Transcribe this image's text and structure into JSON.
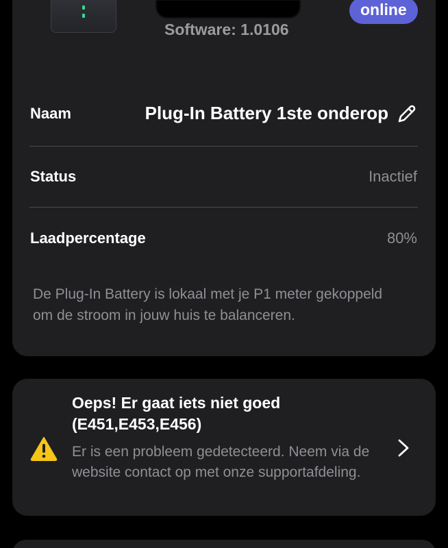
{
  "device": {
    "status_badge": "online",
    "software_version": "Software: 1.0106",
    "name_label": "Naam",
    "name_value": "Plug-In Battery 1ste onderop",
    "status_label": "Status",
    "status_value": "Inactief",
    "charge_label": "Laadpercentage",
    "charge_value": "80%",
    "description": "De Plug-In Battery is lokaal met je P1 meter gekoppeld om de stroom in jouw huis te balanceren."
  },
  "error": {
    "title": "Oeps! Er gaat iets niet goed (E451,E453,E456)",
    "message": "Er is een probleem gedetecteerd. Neem via de website contact op met onze supportafdeling."
  },
  "icons": {
    "edit": "pencil-icon",
    "warning": "warning-triangle-icon",
    "chevron": "chevron-right-icon"
  },
  "colors": {
    "background": "#000000",
    "card": "#1f1f21",
    "accent_badge": "#5d63d6",
    "warning": "#f5c518",
    "muted_text": "#8f8f95"
  }
}
